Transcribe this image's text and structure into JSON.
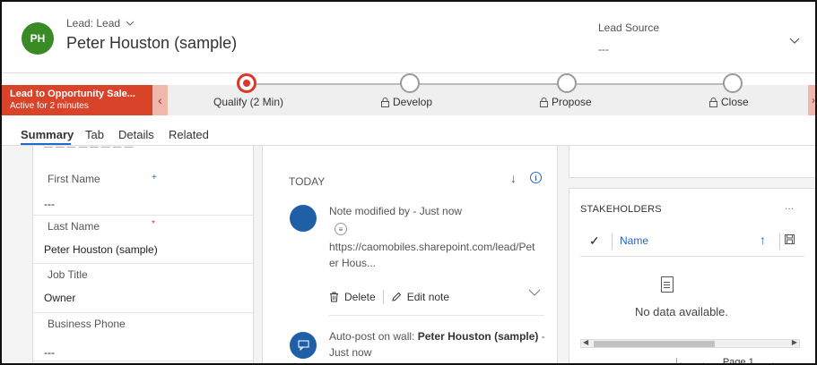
{
  "header": {
    "avatar_initials": "PH",
    "lead_type": "Lead: Lead",
    "lead_name": "Peter Houston (sample)",
    "lead_source_label": "Lead Source",
    "lead_source_value": "---"
  },
  "process": {
    "active_title": "Lead to Opportunity Sale...",
    "active_subtitle": "Active for 2 minutes",
    "stages": [
      {
        "label": "Qualify (2 Min)",
        "locked": false,
        "active": true
      },
      {
        "label": "Develop",
        "locked": true,
        "active": false
      },
      {
        "label": "Propose",
        "locked": true,
        "active": false
      },
      {
        "label": "Close",
        "locked": true,
        "active": false
      }
    ]
  },
  "tabs": [
    "Summary",
    "Tab",
    "Details",
    "Related"
  ],
  "form": {
    "fields": [
      {
        "label": "First Name",
        "value": "---",
        "required_marker": "+"
      },
      {
        "label": "Last Name",
        "value": "Peter Houston (sample)",
        "required_marker": "*"
      },
      {
        "label": "Job Title",
        "value": "Owner",
        "required_marker": ""
      },
      {
        "label": "Business Phone",
        "value": "---",
        "required_marker": ""
      }
    ]
  },
  "timeline": {
    "section": "TODAY",
    "note": {
      "title": "Note modified by - Just now",
      "url": "https://caomobiles.sharepoint.com/lead/Peter Hous...",
      "delete_label": "Delete",
      "edit_label": "Edit note"
    },
    "autopost": {
      "prefix": "Auto-post on wall:",
      "name": "Peter Houston (sample)",
      "suffix": "-",
      "time": "Just now"
    }
  },
  "stakeholders": {
    "title": "STAKEHOLDERS",
    "more": "...",
    "column_name": "Name",
    "empty_text": "No data available.",
    "page_label": "Page 1"
  },
  "colors": {
    "avatar": "#3a8a25",
    "active_stage_bg": "#d9432a",
    "active_stage_ring": "#e0352b",
    "link_blue": "#2266d0",
    "timeline_icon": "#1f5fa8"
  }
}
